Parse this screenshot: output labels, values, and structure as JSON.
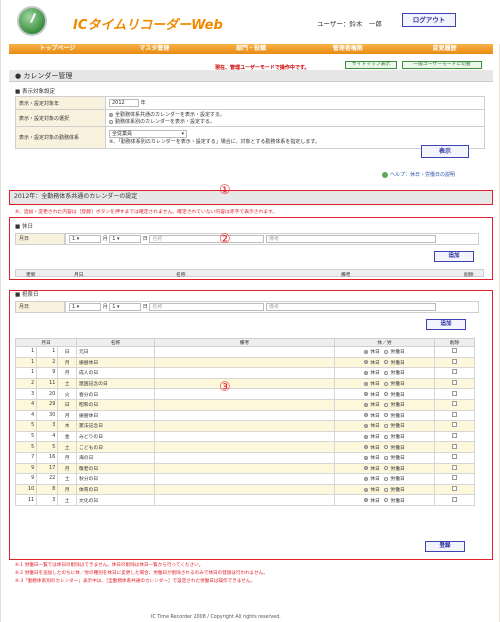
{
  "header": {
    "app_title": "ICタイムリコーダーWeb",
    "user_label": "ユーザー：鈴木　一郎",
    "logout_label": "ログアウト"
  },
  "nav": [
    "トップページ",
    "マスタ管理",
    "部門・役職",
    "管理者権限",
    "変更履歴"
  ],
  "mode_text": "現在、管理ユーザーモードで操作中です。",
  "sitemap_label": "サイトマップ表示",
  "switch_label": "一般ユーザーモードに切替",
  "section_title": "● カレンダー管理",
  "settings": {
    "subtitle": "■ 表示対象設定",
    "year_label": "表示・設定対象年",
    "year_value": "2012",
    "year_unit": "年",
    "select_label": "表示・設定対象の選択",
    "option_common": "全勤務体系共通のカレンダーを表示・設定する。",
    "option_system": "勤務体系別のカレンダーを表示・設定する。",
    "system_label": "表示・設定対象の勤務体系",
    "system_value": "全従業員",
    "system_note": "※、「勤務体系別のカレンダーを表示・設定する」場合に、対象とする勤務体系を指定します。",
    "display_button": "表示"
  },
  "help_text": "ヘルプ：休日・労働日の説明",
  "year_heading": "2012年：全勤務体系共通のカレンダーの設定",
  "warning": "※、追加・変更された内容は［登録］ボタンを押すまでは確定されません。確定されていない内容は赤字で表示されます。",
  "circles": [
    "①",
    "②",
    "③"
  ],
  "closed": {
    "subtitle": "■ 休日",
    "date_label": "月日",
    "month": "1",
    "day": "1",
    "month_unit": "月",
    "day_unit": "日",
    "name_ph": "名称",
    "note_ph": "備考",
    "add_button": "追加",
    "headers": [
      "更新",
      "月日",
      "名称",
      "備考",
      "削除"
    ]
  },
  "holidays": {
    "subtitle": "■ 祝祭日",
    "date_label": "月日",
    "month": "1",
    "day": "1",
    "month_unit": "月",
    "day_unit": "日",
    "name_ph": "名称",
    "note_ph": "備考",
    "add_button": "追加",
    "headers": [
      "月日",
      "名称",
      "備考",
      "休／労",
      "削除"
    ],
    "rest_label": "休日",
    "work_label": "労働日",
    "rows": [
      {
        "m": "1",
        "d": "1",
        "w": "日",
        "name": "元日"
      },
      {
        "m": "1",
        "d": "2",
        "w": "月",
        "name": "振替休日"
      },
      {
        "m": "1",
        "d": "9",
        "w": "月",
        "name": "成人の日"
      },
      {
        "m": "2",
        "d": "11",
        "w": "土",
        "name": "建国記念の日"
      },
      {
        "m": "3",
        "d": "20",
        "w": "火",
        "name": "春分の日"
      },
      {
        "m": "4",
        "d": "29",
        "w": "日",
        "name": "昭和の日"
      },
      {
        "m": "4",
        "d": "30",
        "w": "月",
        "name": "振替休日"
      },
      {
        "m": "5",
        "d": "3",
        "w": "木",
        "name": "憲法記念日"
      },
      {
        "m": "5",
        "d": "4",
        "w": "金",
        "name": "みどりの日"
      },
      {
        "m": "5",
        "d": "5",
        "w": "土",
        "name": "こどもの日"
      },
      {
        "m": "7",
        "d": "16",
        "w": "月",
        "name": "海の日"
      },
      {
        "m": "9",
        "d": "17",
        "w": "月",
        "name": "敬老の日"
      },
      {
        "m": "9",
        "d": "22",
        "w": "土",
        "name": "秋分の日"
      },
      {
        "m": "10",
        "d": "8",
        "w": "月",
        "name": "体育の日"
      },
      {
        "m": "11",
        "d": "3",
        "w": "土",
        "name": "文化の日"
      }
    ],
    "register_button": "登録"
  },
  "notes": [
    "※.1 労働日一覧では休日の削除はできません。休日の削除は休日一覧から行ってください。",
    "※.2 労働日を追加したのちに休／労の種別を休日に変更した場合、労働日が削除されるのみで休日の登録は行われません。",
    "※.3「勤務体系別のカレンダー」表示中は、［全勤務体系共通のカレンダー］で設定された労働日は操作できません。"
  ],
  "footer": "IC Time Recorder 2008 / Copyright All rights reserved."
}
